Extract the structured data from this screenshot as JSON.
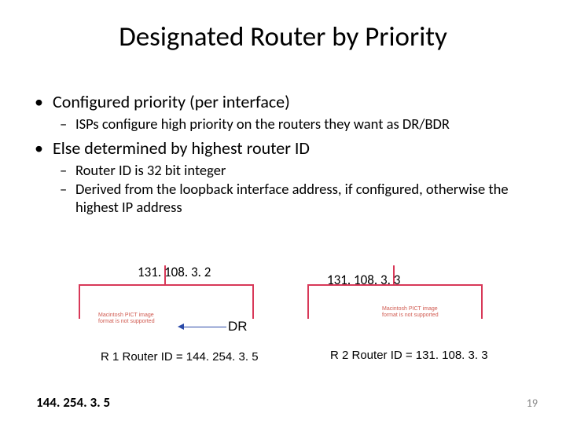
{
  "title": "Designated Router by Priority",
  "bullets": {
    "b1": "Configured priority (per interface)",
    "b1_1": "ISPs configure high priority on the routers they want as DR/BDR",
    "b2": "Else determined by highest router ID",
    "b2_1": "Router ID is 32 bit integer",
    "b2_2": "Derived from the loopback interface address, if configured, otherwise the highest IP address"
  },
  "diagram": {
    "ip_left": "131. 108. 3. 2",
    "ip_right": "131. 108. 3. 3",
    "dr_label": "DR",
    "router_left": "R 1 Router ID = 144. 254. 3. 5",
    "router_right": "R 2 Router ID = 131. 108. 3. 3",
    "pict_placeholder": "Macintosh PICT image format is not supported"
  },
  "footer_ip": "144. 254. 3. 5",
  "slide_number": "19"
}
